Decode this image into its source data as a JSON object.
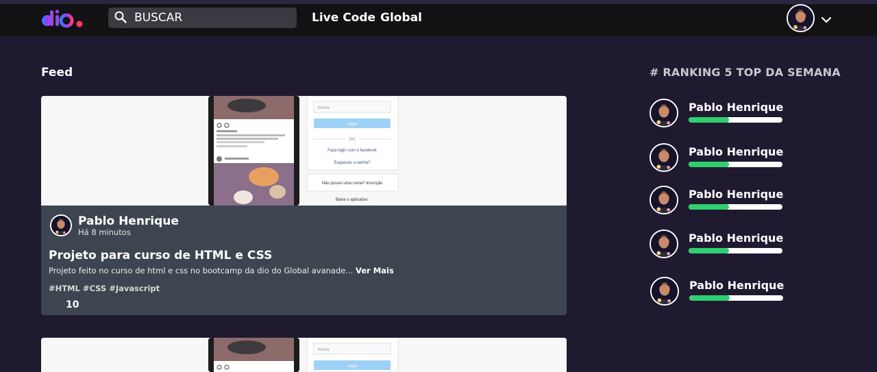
{
  "header": {
    "search": {
      "placeholder": "BUSCAR"
    },
    "nav": [
      {
        "label": "Live Code"
      },
      {
        "label": "Global"
      }
    ]
  },
  "feed": {
    "title": "Feed",
    "posts": [
      {
        "author": "Pablo Henrique",
        "time": "Há 8 minutos",
        "title": "Projeto para curso de HTML e CSS",
        "description": "Projeto feito no curso de html e css no bootcamp da dio do Global avanade...",
        "more_label": "Ver Mais",
        "tags": "#HTML #CSS #Javascript",
        "likes": "10",
        "image": {
          "password_placeholder": "Senha",
          "login_button": "Login",
          "or_text": "OU",
          "facebook_text": "Faça login com o facebook",
          "forgot_text": "Esqueceu a senha?",
          "signup_text": "Não possui uma conta? Inscrição",
          "download_text": "Baixe o aplicativo."
        }
      },
      {
        "image": {
          "password_placeholder": "Senha",
          "login_button": "Login"
        }
      }
    ]
  },
  "ranking": {
    "title": "# RANKING 5 TOP DA SEMANA",
    "items": [
      {
        "name": "Pablo Henrique",
        "progress": 0.43
      },
      {
        "name": "Pablo Henrique",
        "progress": 0.43
      },
      {
        "name": "Pablo Henrique",
        "progress": 0.43
      },
      {
        "name": "Pablo Henrique",
        "progress": 0.43
      },
      {
        "name": "Pablo Henrique",
        "progress": 0.43
      }
    ]
  },
  "colors": {
    "background": "#1f1a30",
    "header": "#121214",
    "card_body": "#3d4550",
    "progress": "#2ecf6f"
  }
}
